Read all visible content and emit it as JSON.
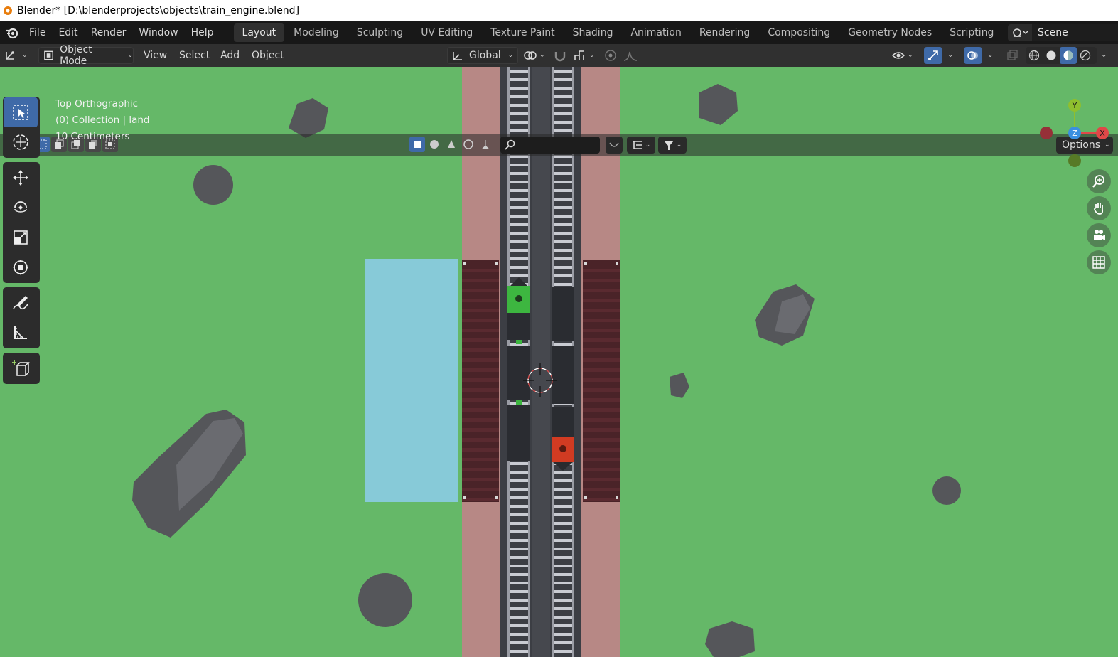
{
  "window": {
    "title": "Blender* [D:\\blenderprojects\\objects\\train_engine.blend]"
  },
  "menu": {
    "items": [
      "File",
      "Edit",
      "Render",
      "Window",
      "Help"
    ]
  },
  "workspaces": {
    "tabs": [
      "Layout",
      "Modeling",
      "Sculpting",
      "UV Editing",
      "Texture Paint",
      "Shading",
      "Animation",
      "Rendering",
      "Compositing",
      "Geometry Nodes",
      "Scripting"
    ],
    "active": "Layout",
    "add_symbol": "+"
  },
  "scene": {
    "name": "Scene"
  },
  "viewport_header": {
    "mode": "Object Mode",
    "menus": [
      "View",
      "Select",
      "Add",
      "Object"
    ],
    "orientation": "Global",
    "options_label": "Options"
  },
  "viewport": {
    "view_name": "Top Orthographic",
    "collection": "(0) Collection | land",
    "scale": "10 Centimeters"
  },
  "gizmo": {
    "y": "Y",
    "z": "Z",
    "x": "X"
  },
  "colors": {
    "grass": "#65b868",
    "water": "#87cad8",
    "platform": "#b78885",
    "bridge": "#4a2328",
    "track_bed": "#3c3e44",
    "engine_green": "#3db640",
    "engine_red": "#d13b22",
    "rock": "#55565a",
    "active_tool": "#3f6aa8"
  }
}
